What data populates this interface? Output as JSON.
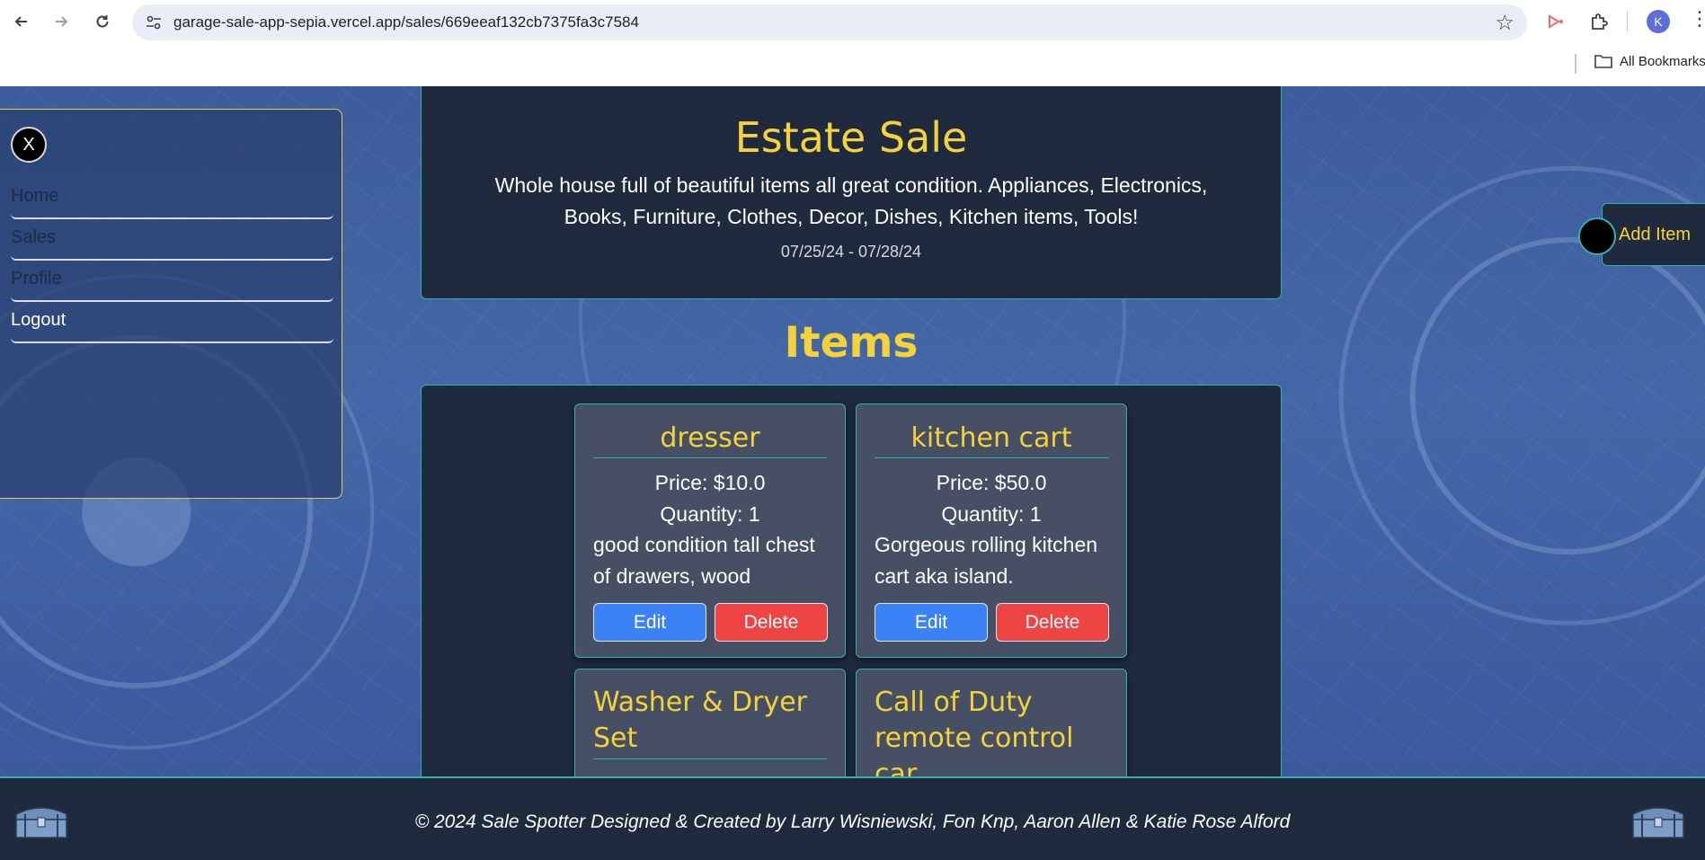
{
  "browser": {
    "url": "garage-sale-app-sepia.vercel.app/sales/669eeaf132cb7375fa3c7584",
    "profile_initial": "K",
    "bookmarks_label": "All Bookmarks"
  },
  "sidebar": {
    "close_label": "X",
    "items": [
      {
        "label": "Home"
      },
      {
        "label": "Sales"
      },
      {
        "label": "Profile"
      },
      {
        "label": "Logout"
      }
    ]
  },
  "sale": {
    "title": "Estate Sale",
    "description": "Whole house full of beautiful items all great condition. Appliances, Electronics, Books, Furniture, Clothes, Decor, Dishes, Kitchen items, Tools!",
    "dates": "07/25/24 - 07/28/24"
  },
  "items_heading": "Items",
  "add_item_label": "Add Item",
  "items": [
    {
      "name": "dresser",
      "price": "Price: $10.0",
      "quantity": "Quantity: 1",
      "description": "good condition tall chest of drawers, wood",
      "edit": "Edit",
      "delete": "Delete"
    },
    {
      "name": "kitchen cart",
      "price": "Price: $50.0",
      "quantity": "Quantity: 1",
      "description": "Gorgeous rolling kitchen cart aka island.",
      "edit": "Edit",
      "delete": "Delete"
    },
    {
      "name": "Washer & Dryer Set"
    },
    {
      "name": "Call of Duty remote control car"
    }
  ],
  "footer": {
    "text": "© 2024 Sale Spotter Designed & Created by Larry Wisniewski, Fon Knp, Aaron Allen & Katie Rose Alford"
  },
  "colors": {
    "accent_yellow": "#f4d23a",
    "panel_bg": "#1f2a3e",
    "border_teal": "#2fb3a8",
    "edit_blue": "#3b82f6",
    "delete_red": "#ef4444"
  }
}
